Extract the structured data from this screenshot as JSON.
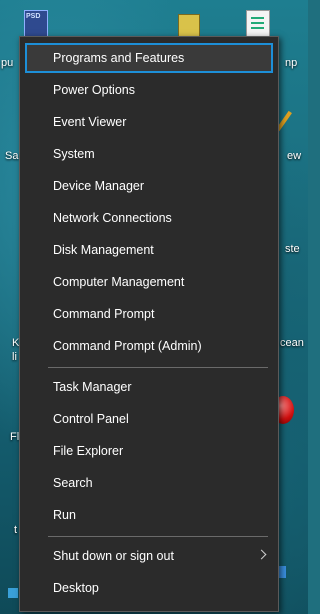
{
  "desktop": {
    "labels": {
      "top_left": "pu",
      "top_right": "np",
      "left_sa": "Sa",
      "right_ew": "ew",
      "right_ste": "ste",
      "left_k": "K",
      "left_li": "li",
      "right_cean": "cean",
      "left_fl": "Fl",
      "left_t": "t"
    },
    "psd_badge": "PSD"
  },
  "menu": {
    "items_group1": [
      "Programs and Features",
      "Power Options",
      "Event Viewer",
      "System",
      "Device Manager",
      "Network Connections",
      "Disk Management",
      "Computer Management",
      "Command Prompt",
      "Command Prompt (Admin)"
    ],
    "items_group2": [
      "Task Manager",
      "Control Panel",
      "File Explorer",
      "Search",
      "Run"
    ],
    "items_group3": [
      "Shut down or sign out",
      "Desktop"
    ],
    "selected_item": "Programs and Features"
  },
  "colors": {
    "menu_bg": "#2b2b2b",
    "selection_border": "#1d8fd8",
    "text": "#ffffff"
  }
}
